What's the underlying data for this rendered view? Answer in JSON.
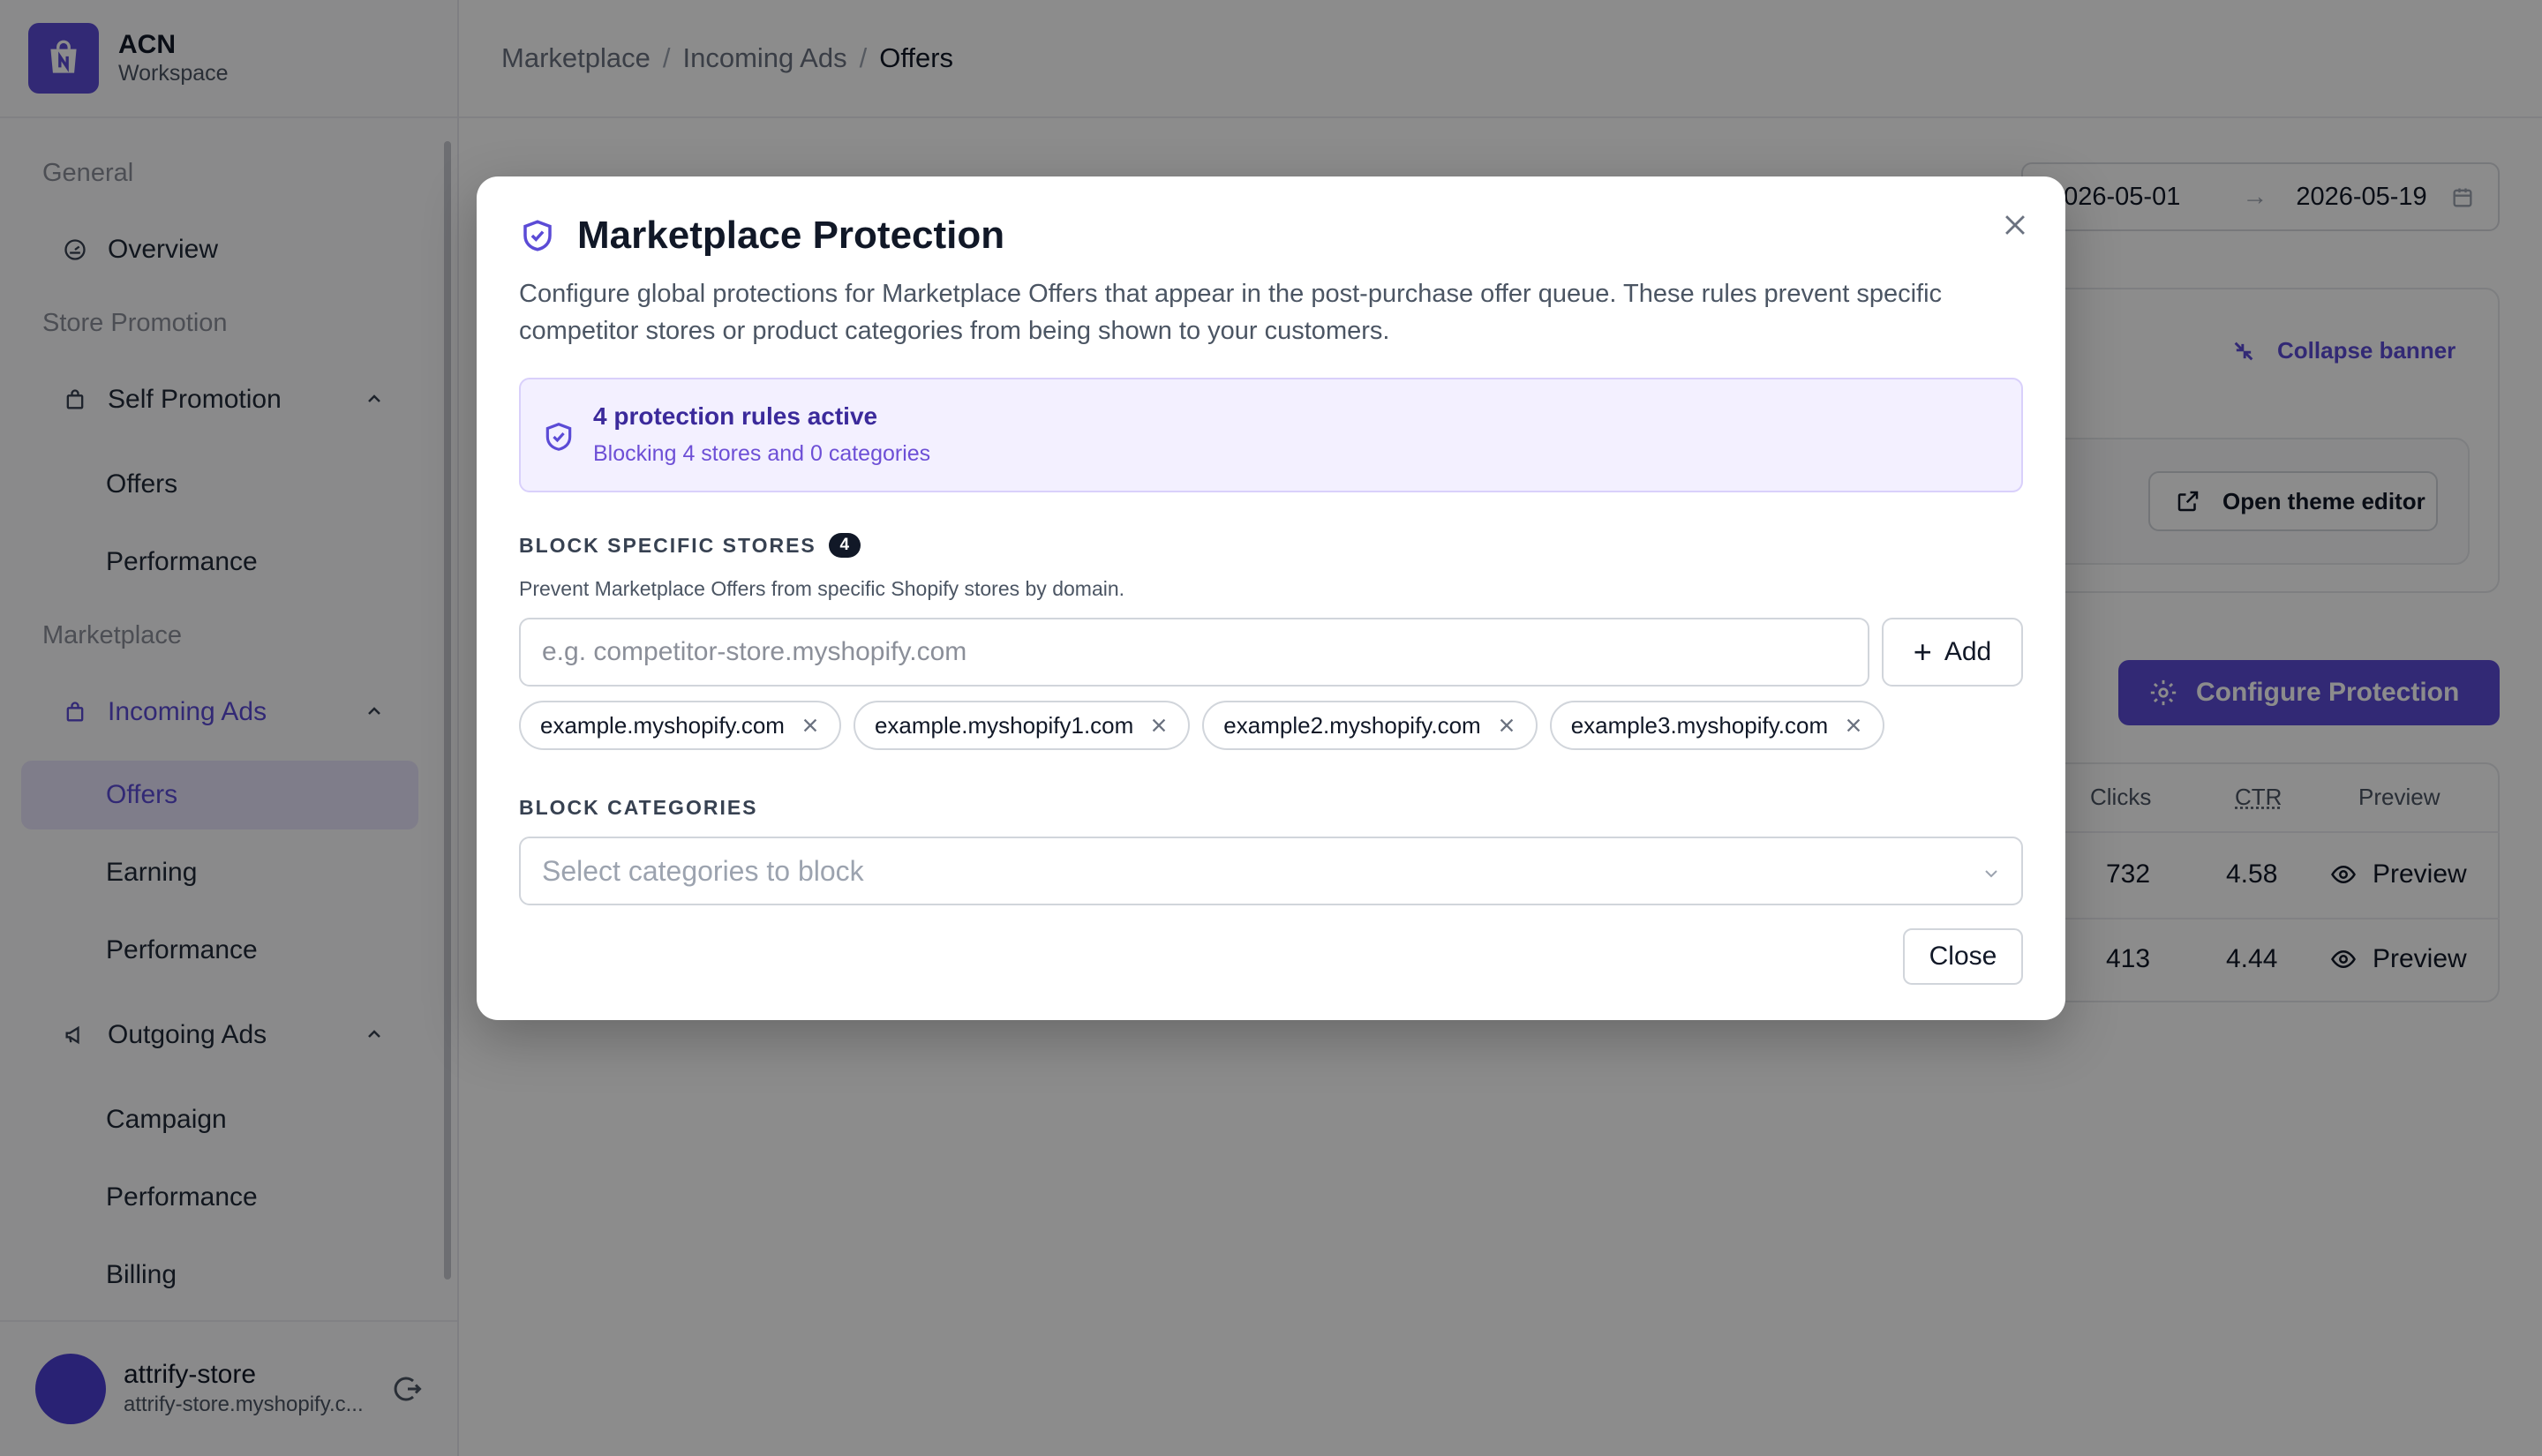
{
  "brand": {
    "name": "ACN",
    "subtitle": "Workspace"
  },
  "sidebar": {
    "sections": [
      {
        "label": "General"
      },
      {
        "label": "Store Promotion"
      },
      {
        "label": "Marketplace"
      }
    ],
    "items": {
      "overview": "Overview",
      "self_promotion": "Self Promotion",
      "self_offers": "Offers",
      "self_performance": "Performance",
      "incoming_ads": "Incoming Ads",
      "incoming_offers": "Offers",
      "incoming_earning": "Earning",
      "incoming_performance": "Performance",
      "outgoing_ads": "Outgoing Ads",
      "outgoing_campaign": "Campaign",
      "outgoing_performance": "Performance",
      "outgoing_billing": "Billing"
    },
    "active_item": "incoming_offers"
  },
  "user": {
    "name": "attrify-store",
    "domain": "attrify-store.myshopify.c..."
  },
  "breadcrumb": {
    "items": [
      "Marketplace",
      "Incoming Ads",
      "Offers"
    ],
    "separator": "/"
  },
  "date_range": {
    "start": "2026-05-01",
    "end": "2026-05-19",
    "arrow": "→"
  },
  "banner": {
    "collapse_label": "Collapse banner",
    "theme_editor_label": "Open theme editor"
  },
  "configure_button": "Configure Protection",
  "table": {
    "headers": {
      "clicks": "Clicks",
      "ctr": "CTR",
      "preview": "Preview"
    },
    "rows": [
      {
        "clicks": "732",
        "ctr": "4.58",
        "preview": "Preview"
      },
      {
        "clicks": "413",
        "ctr": "4.44",
        "preview": "Preview"
      }
    ]
  },
  "modal": {
    "title": "Marketplace Protection",
    "description": "Configure global protections for Marketplace Offers that appear in the post-purchase offer queue. These rules prevent specific competitor stores or product categories from being shown to your customers.",
    "status": {
      "title": "4 protection rules active",
      "subtitle": "Blocking 4 stores and 0 categories"
    },
    "stores": {
      "label": "BLOCK SPECIFIC STORES",
      "count": "4",
      "help": "Prevent Marketplace Offers from specific Shopify stores by domain.",
      "input_placeholder": "e.g. competitor-store.myshopify.com",
      "add_label": "Add",
      "chips": [
        "example.myshopify.com",
        "example.myshopify1.com",
        "example2.myshopify.com",
        "example3.myshopify.com"
      ]
    },
    "categories": {
      "label": "BLOCK CATEGORIES",
      "placeholder": "Select categories to block"
    },
    "close_label": "Close"
  },
  "colors": {
    "accent": "#5b4bd6",
    "accent_light": "#e8e4fb",
    "overlay": "rgba(0,0,0,0.45)"
  },
  "icons": {
    "brand": "shopping-bag-icon",
    "overview": "gauge-icon",
    "self_promotion": "bag-icon",
    "incoming_ads": "bag-icon",
    "outgoing_ads": "megaphone-icon",
    "logout": "logout-icon",
    "modal": "shield-check-icon",
    "close": "close-icon"
  }
}
